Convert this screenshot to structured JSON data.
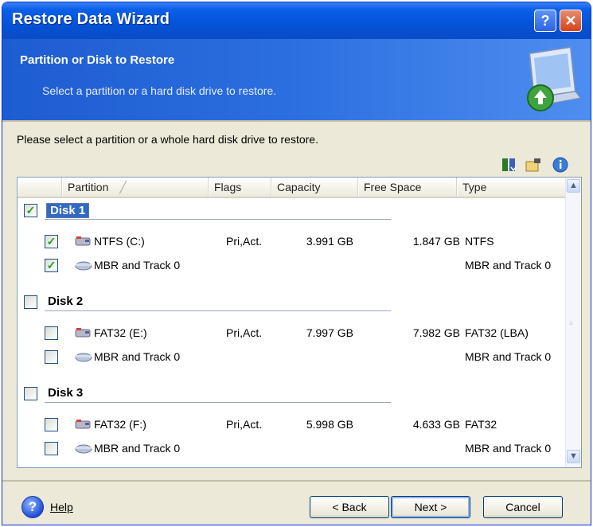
{
  "window": {
    "title": "Restore Data Wizard",
    "help_glyph": "?",
    "close_glyph": "✕"
  },
  "header": {
    "title": "Partition or Disk to Restore",
    "subtitle": "Select a partition or a hard disk drive to restore."
  },
  "instruction": "Please select a partition or a whole hard disk drive to restore.",
  "toolbar_icons": [
    "sort-icon",
    "folder-icon",
    "info-icon"
  ],
  "columns": {
    "partition": "Partition",
    "flags": "Flags",
    "capacity": "Capacity",
    "free_space": "Free Space",
    "type": "Type"
  },
  "disks": [
    {
      "label": "Disk 1",
      "checked": true,
      "selected": true,
      "rows": [
        {
          "name": "NTFS (C:)",
          "flags": "Pri,Act.",
          "capacity": "3.991 GB",
          "free": "1.847 GB",
          "type": "NTFS",
          "checked": true
        },
        {
          "name": "MBR and Track 0",
          "flags": "",
          "capacity": "",
          "free": "",
          "type": "MBR and Track 0",
          "checked": true
        }
      ]
    },
    {
      "label": "Disk 2",
      "checked": false,
      "selected": false,
      "rows": [
        {
          "name": "FAT32 (E:)",
          "flags": "Pri,Act.",
          "capacity": "7.997 GB",
          "free": "7.982 GB",
          "type": "FAT32 (LBA)",
          "checked": false
        },
        {
          "name": "MBR and Track 0",
          "flags": "",
          "capacity": "",
          "free": "",
          "type": "MBR and Track 0",
          "checked": false
        }
      ]
    },
    {
      "label": "Disk 3",
      "checked": false,
      "selected": false,
      "rows": [
        {
          "name": "FAT32 (F:)",
          "flags": "Pri,Act.",
          "capacity": "5.998 GB",
          "free": "4.633 GB",
          "type": "FAT32",
          "checked": false
        },
        {
          "name": "MBR and Track 0",
          "flags": "",
          "capacity": "",
          "free": "",
          "type": "MBR and Track 0",
          "checked": false
        }
      ]
    }
  ],
  "check_glyph": "✓",
  "footer": {
    "help_glyph": "?",
    "help": "Help",
    "back": "< Back",
    "next": "Next >",
    "cancel": "Cancel"
  },
  "colors": {
    "title_bar": "#0453d8",
    "selection": "#316ac5",
    "window_bg": "#ece9d8"
  }
}
